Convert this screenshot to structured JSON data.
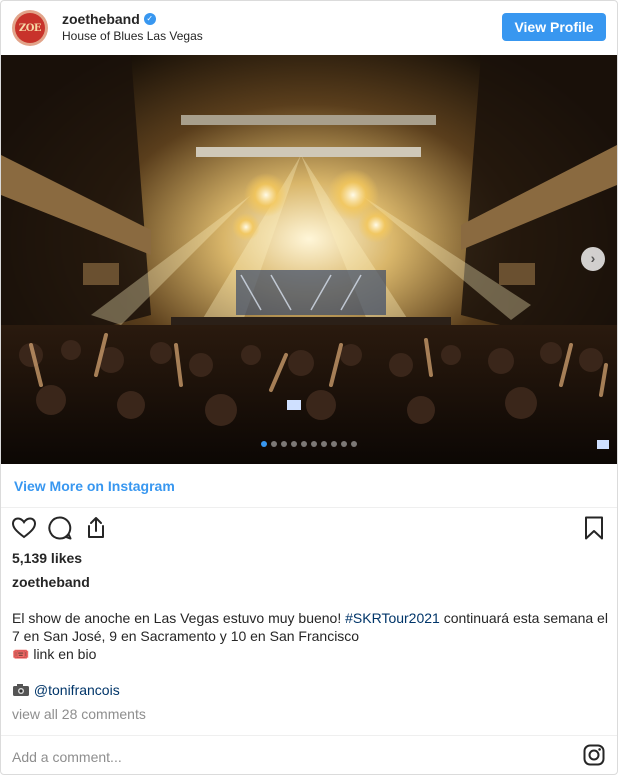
{
  "header": {
    "avatar_text": "ZOE",
    "username": "zoetheband",
    "location": "House of Blues Las Vegas",
    "view_profile_label": "View Profile"
  },
  "photo": {
    "carousel_dots": 10,
    "active_dot": 1,
    "next_icon": "chevron-right-icon"
  },
  "view_more_label": "View More on Instagram",
  "actions": {
    "icons": [
      "heart-icon",
      "comment-icon",
      "share-icon",
      "bookmark-icon"
    ]
  },
  "likes": "5,139 likes",
  "caption": {
    "username": "zoetheband",
    "text_part1": "El show de anoche en Las Vegas estuvo muy bueno! ",
    "hashtag": "#SKRTour2021",
    "text_part2": " continuará esta semana el 7 en San José, 9 en Sacramento y 10 en San Francisco",
    "ticket_emoji": "🎟️",
    "link_text": " link en bio",
    "credit_mention": "@tonifrancois"
  },
  "comments_link": "view all 28 comments",
  "add_comment_placeholder": "Add a comment...",
  "colors": {
    "accent": "#3897f0",
    "hashtag": "#003569",
    "muted": "#8e8e8e"
  }
}
